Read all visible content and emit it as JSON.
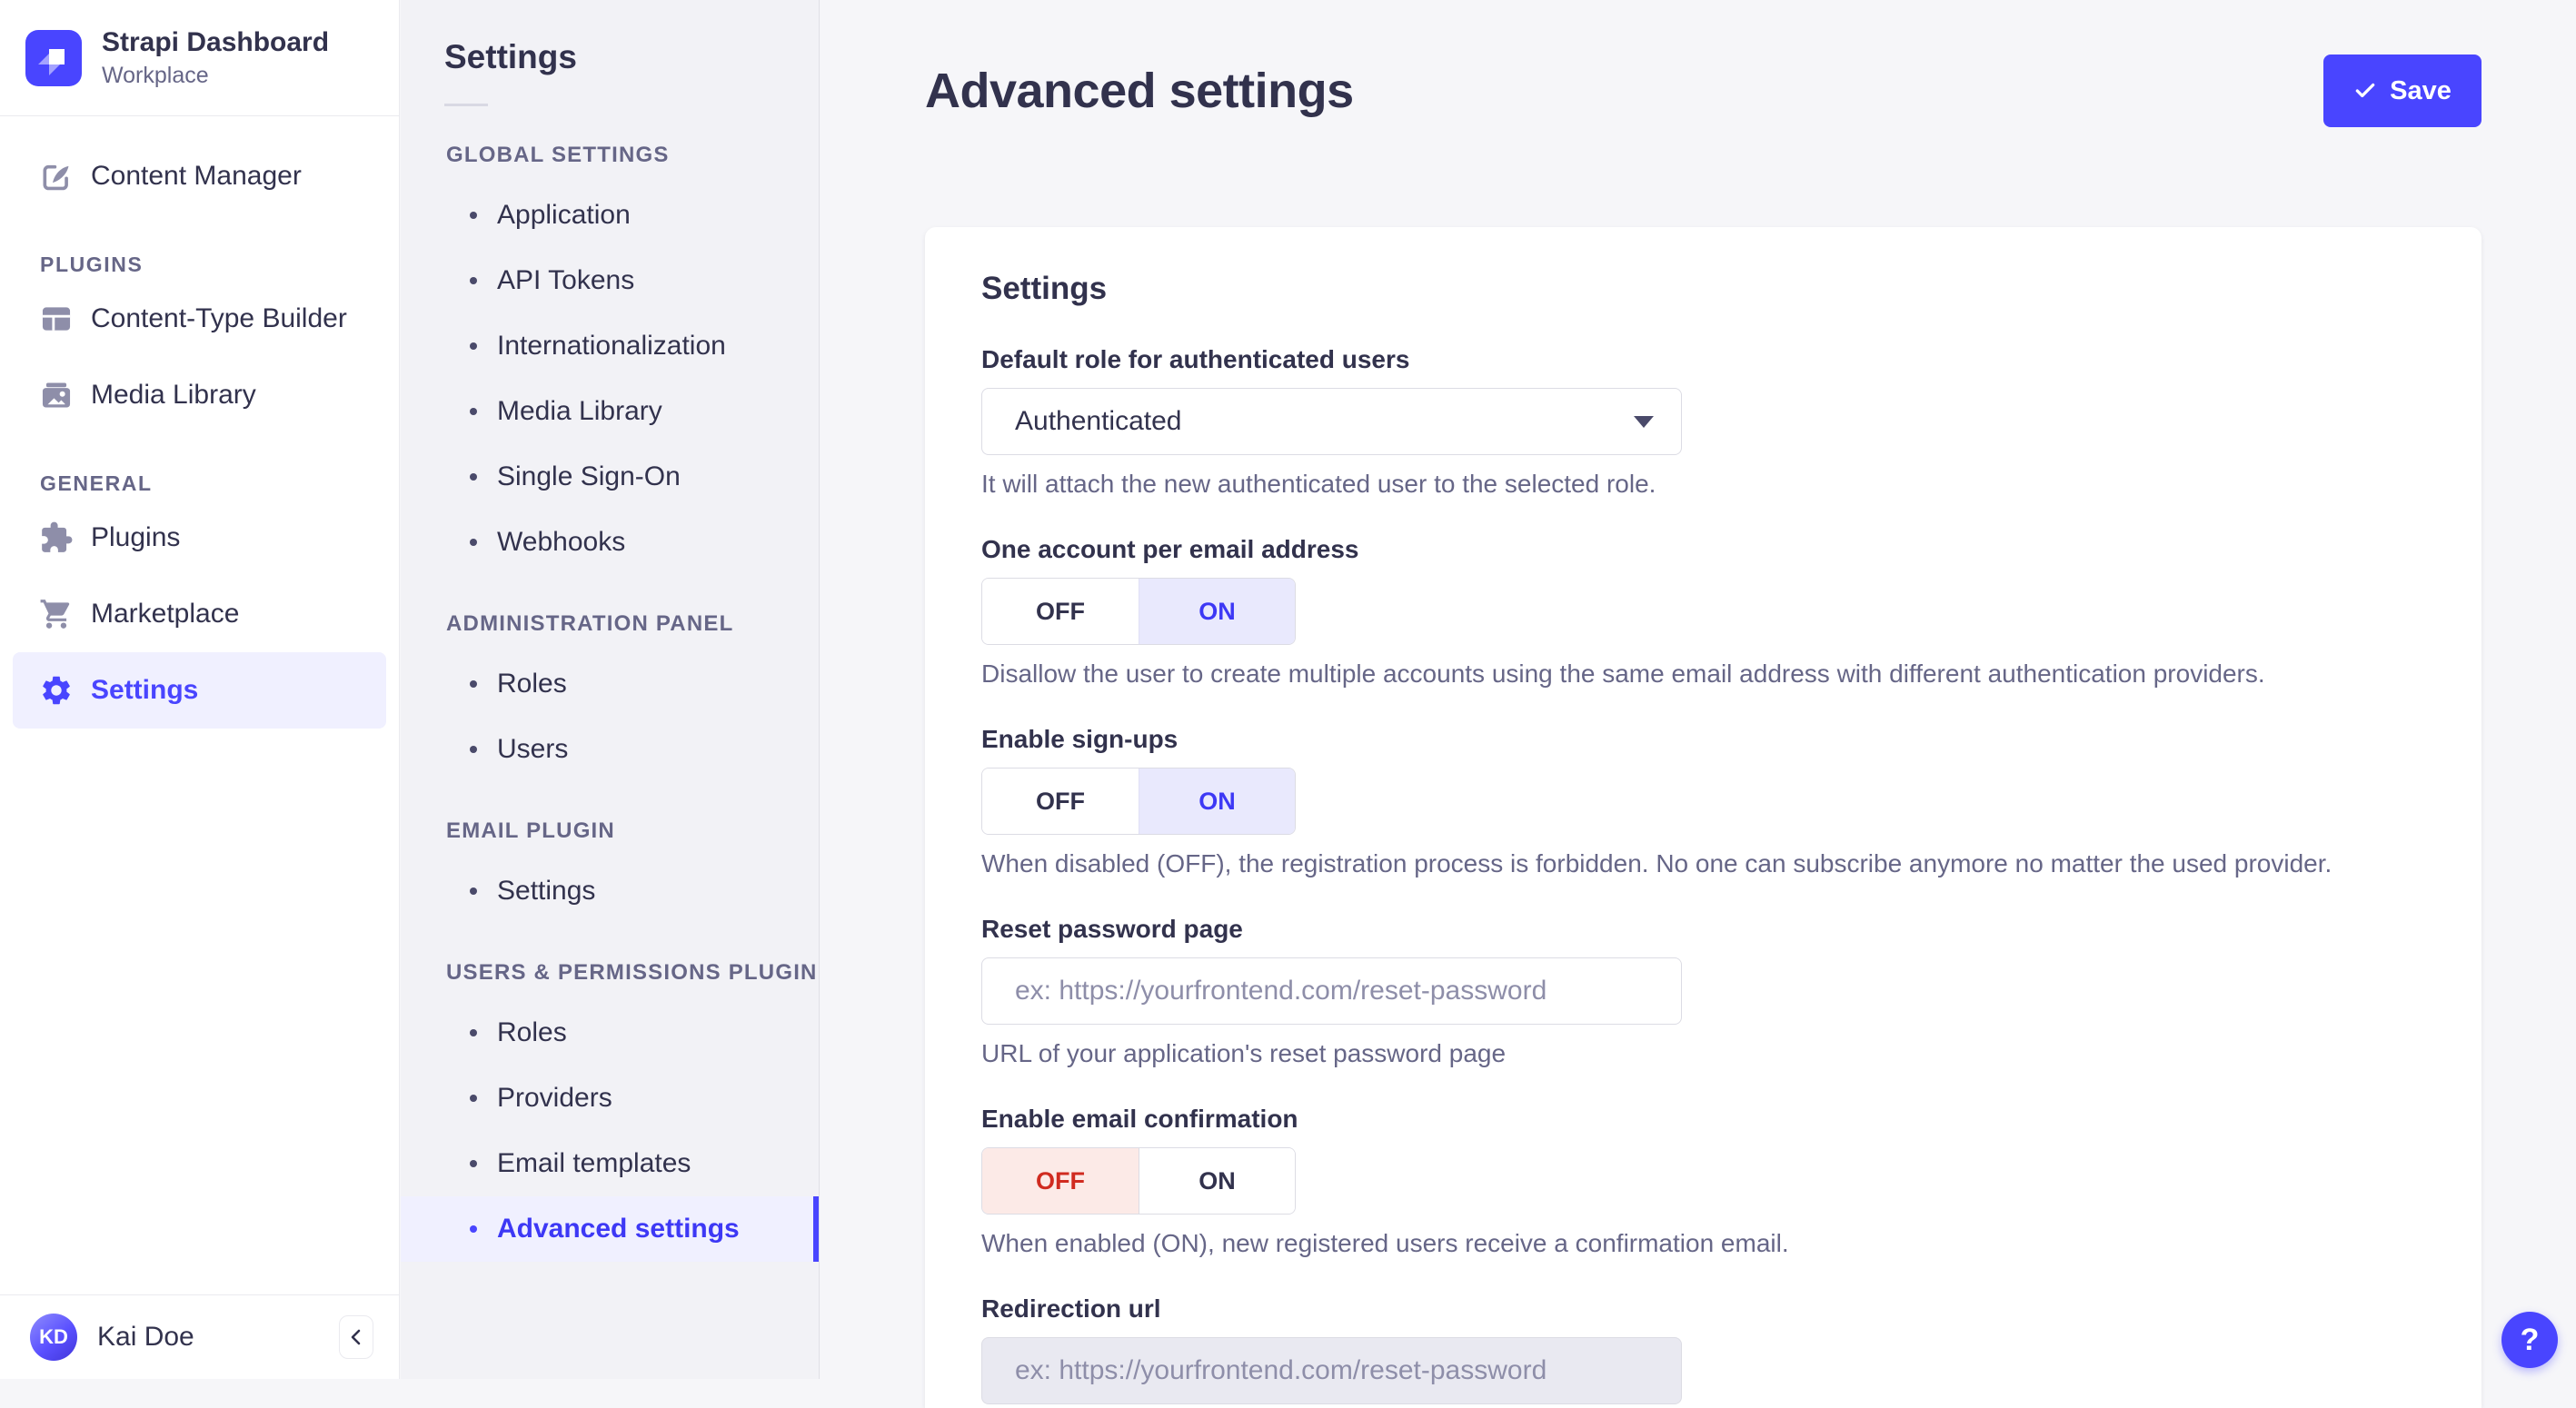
{
  "brand": {
    "title": "Strapi Dashboard",
    "subtitle": "Workplace"
  },
  "sidebar": {
    "main_item": {
      "label": "Content Manager",
      "icon": "content-manager-icon"
    },
    "sections": [
      {
        "header": "PLUGINS",
        "items": [
          {
            "label": "Content-Type Builder",
            "icon": "content-type-builder-icon"
          },
          {
            "label": "Media Library",
            "icon": "media-library-icon"
          }
        ]
      },
      {
        "header": "GENERAL",
        "items": [
          {
            "label": "Plugins",
            "icon": "plugins-icon"
          },
          {
            "label": "Marketplace",
            "icon": "marketplace-icon"
          },
          {
            "label": "Settings",
            "icon": "settings-gear-icon",
            "active": true
          }
        ]
      }
    ],
    "user": {
      "initials": "KD",
      "name": "Kai Doe"
    }
  },
  "subnav": {
    "title": "Settings",
    "active_item": "Advanced settings",
    "sections": [
      {
        "header": "GLOBAL SETTINGS",
        "items": [
          "Application",
          "API Tokens",
          "Internationalization",
          "Media Library",
          "Single Sign-On",
          "Webhooks"
        ]
      },
      {
        "header": "ADMINISTRATION PANEL",
        "items": [
          "Roles",
          "Users"
        ]
      },
      {
        "header": "EMAIL PLUGIN",
        "items": [
          "Settings"
        ]
      },
      {
        "header": "USERS & PERMISSIONS PLUGIN",
        "items": [
          "Roles",
          "Providers",
          "Email templates",
          "Advanced settings"
        ]
      }
    ]
  },
  "page": {
    "title": "Advanced settings",
    "save_label": "Save"
  },
  "form": {
    "title": "Settings",
    "toggle": {
      "off": "OFF",
      "on": "ON"
    },
    "fields": [
      {
        "label": "Default role for authenticated users",
        "type": "select",
        "value": "Authenticated",
        "hint": "It will attach the new authenticated user to the selected role."
      },
      {
        "label": "One account per email address",
        "type": "toggle",
        "value": "ON",
        "hint": "Disallow the user to create multiple accounts using the same email address with different authentication providers."
      },
      {
        "label": "Enable sign-ups",
        "type": "toggle",
        "value": "ON",
        "hint": "When disabled (OFF), the registration process is forbidden. No one can subscribe anymore no matter the used provider."
      },
      {
        "label": "Reset password page",
        "type": "text",
        "placeholder": "ex: https://yourfrontend.com/reset-password",
        "hint": "URL of your application's reset password page"
      },
      {
        "label": "Enable email confirmation",
        "type": "toggle",
        "value": "OFF",
        "hint": "When enabled (ON), new registered users receive a confirmation email."
      },
      {
        "label": "Redirection url",
        "type": "text",
        "disabled": true,
        "placeholder": "ex: https://yourfrontend.com/reset-password"
      }
    ]
  },
  "help": {
    "label": "?"
  },
  "colors": {
    "accent": "#4945ff",
    "accent_light": "#f0f0ff",
    "danger": "#d02b20",
    "danger_light": "#fceae7",
    "text": "#32324d",
    "muted": "#666687"
  }
}
